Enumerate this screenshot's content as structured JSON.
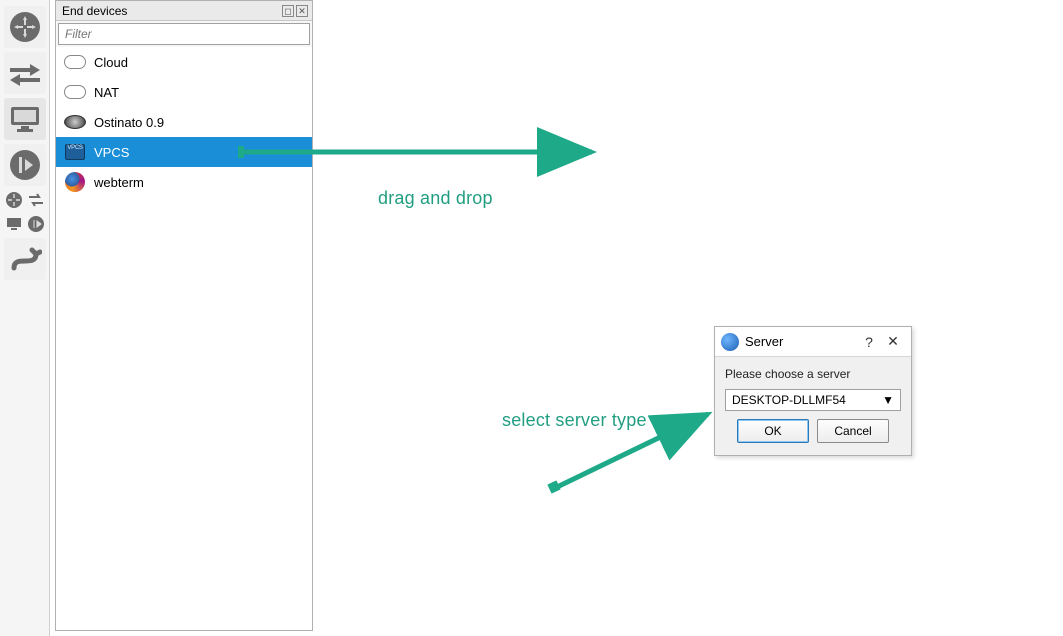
{
  "panel": {
    "title": "End devices",
    "filter_placeholder": "Filter"
  },
  "devices": [
    {
      "name": "Cloud",
      "icon": "cloud"
    },
    {
      "name": "NAT",
      "icon": "cloud"
    },
    {
      "name": "Ostinato 0.9",
      "icon": "ostinato"
    },
    {
      "name": "VPCS",
      "icon": "vpcs",
      "selected": true
    },
    {
      "name": "webterm",
      "icon": "firefox"
    }
  ],
  "dialog": {
    "title": "Server",
    "prompt": "Please choose a server",
    "selected": "DESKTOP-DLLMF54",
    "ok": "OK",
    "cancel": "Cancel"
  },
  "annotations": {
    "drag_label": "drag and drop",
    "select_label": "select server type"
  },
  "colors": {
    "accent_green": "#1ea988",
    "selection_blue": "#1a8fd8"
  }
}
